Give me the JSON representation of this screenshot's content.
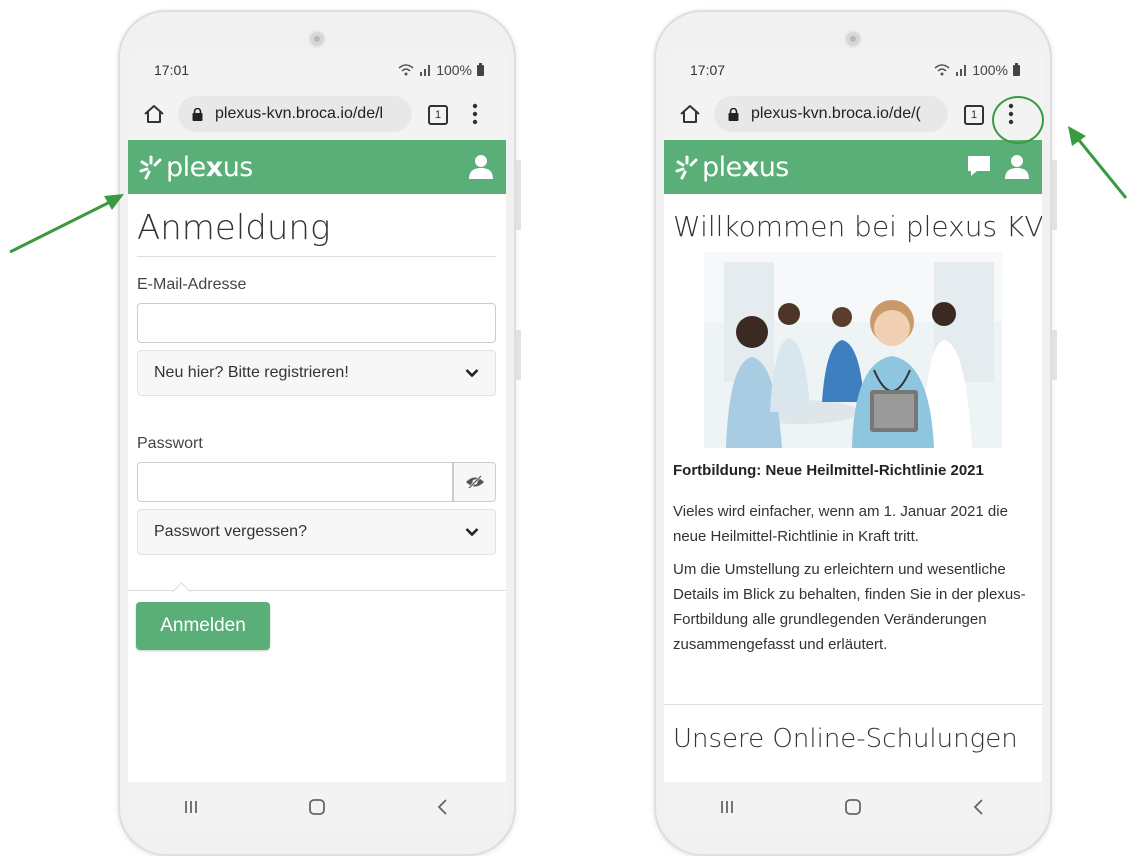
{
  "left_phone": {
    "status": {
      "time": "17:01",
      "battery": "100%"
    },
    "browser": {
      "url": "plexus-kvn.broca.io/de/l",
      "tab_count": "1"
    },
    "app": {
      "logo_text_pre": "plexus",
      "logo_brand_color": "#5aae77"
    },
    "login": {
      "title": "Anmeldung",
      "email_label": "E-Mail-Adresse",
      "email_value": "",
      "register_toggle": "Neu hier? Bitte registrieren!",
      "password_label": "Passwort",
      "password_value": "",
      "forgot_toggle": "Passwort vergessen?",
      "submit_label": "Anmelden"
    }
  },
  "right_phone": {
    "status": {
      "time": "17:07",
      "battery": "100%"
    },
    "browser": {
      "url": "plexus-kvn.broca.io/de/(",
      "tab_count": "1"
    },
    "app": {
      "logo_text_pre": "plexus"
    },
    "home": {
      "welcome": "Willkommen bei plexus KVN!",
      "article_title": "Fortbildung: Neue Heilmittel-Richtlinie 2021",
      "para1": "Vieles wird einfacher, wenn am 1. Januar 2021 die neue Heilmittel-Richtlinie in Kraft tritt.",
      "para2": "Um die Umstellung zu erleichtern und wesentliche Details im Blick zu behalten, finden Sie in der plexus-Fortbildung alle grundlegenden Veränderungen zusammengefasst und erläutert.",
      "section_title": "Unsere Online-Schulungen"
    }
  },
  "annotations": {
    "arrow_color": "#3a9a3e"
  }
}
